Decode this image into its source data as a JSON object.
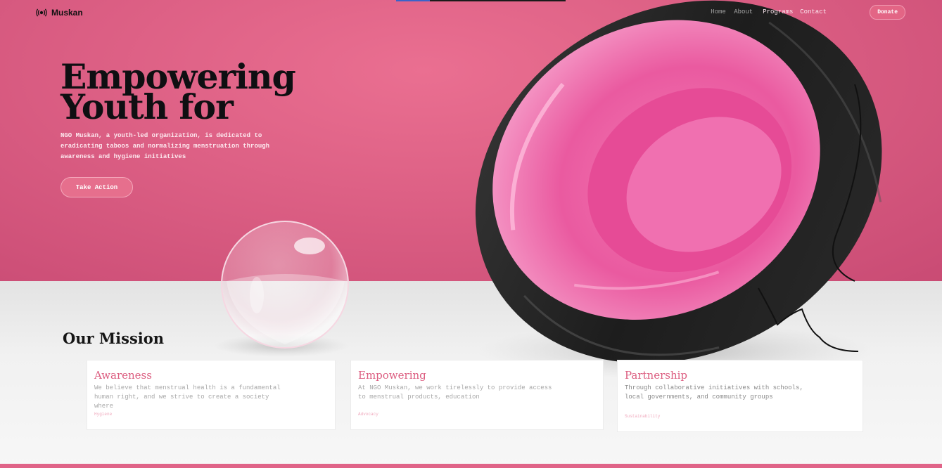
{
  "brand": {
    "name": "Muskan",
    "logo_icon": "broadcast-icon",
    "accent": "#e36585"
  },
  "nav": {
    "items": [
      "Home",
      "About",
      "Programs",
      "Contact"
    ],
    "donate_label": "Donate"
  },
  "hero": {
    "title_line1": "Empowering",
    "title_line2": "Youth for",
    "subtitle": "NGO Muskan, a youth-led organization, is dedicated to eradicating taboos and normalizing menstruation through awareness and hygiene initiatives",
    "cta_label": "Take Action"
  },
  "mission": {
    "title": "Our Mission",
    "cards": [
      {
        "title": "Awareness",
        "text": "We believe that menstrual health is a fundamental human right, and we strive to create a society where",
        "tag": "Hygiene"
      },
      {
        "title": "Empowering",
        "text": "At NGO Muskan, we work tirelessly to provide access to menstrual products, education",
        "tag": "Advocacy"
      },
      {
        "title": "Partnership",
        "text": "Through collaborative initiatives with schools, local governments, and community groups",
        "tag": "Sustainability"
      }
    ]
  }
}
